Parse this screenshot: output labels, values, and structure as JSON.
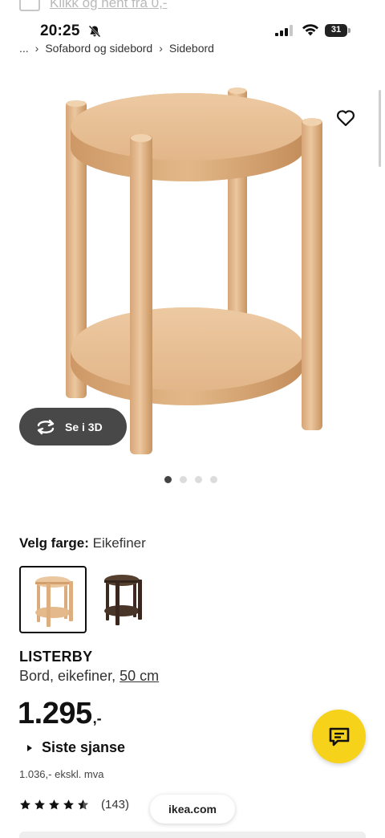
{
  "banner": {
    "text": "Klikk og hent fra 0,-",
    "icon": "truck-icon"
  },
  "status": {
    "time": "20:25",
    "battery": "31",
    "bell_icon": "bell-slash-icon"
  },
  "breadcrumb": {
    "ellipsis": "...",
    "items": [
      "Sofabord og sidebord",
      "Sidebord"
    ]
  },
  "image": {
    "carousel_index": 1,
    "carousel_count": 4,
    "view_3d_label": "Se i 3D"
  },
  "color": {
    "label": "Velg farge:",
    "value": "Eikefiner"
  },
  "product": {
    "name": "LISTERBY",
    "description": "Bord, eikefiner,",
    "size": "50 cm",
    "price": "1.295",
    "price_suffix": ",-",
    "sale_label": "Siste sjanse",
    "ex_vat": "1.036,- ekskl. mva",
    "rating_stars": 4.5,
    "rating_count": "(143)"
  },
  "browser": {
    "url": "ikea.com"
  },
  "colors": {
    "accent_yellow": "#f7d21a",
    "button_dark": "#484848",
    "wood": "#e0b48a",
    "dark_wood": "#3b2a22"
  }
}
